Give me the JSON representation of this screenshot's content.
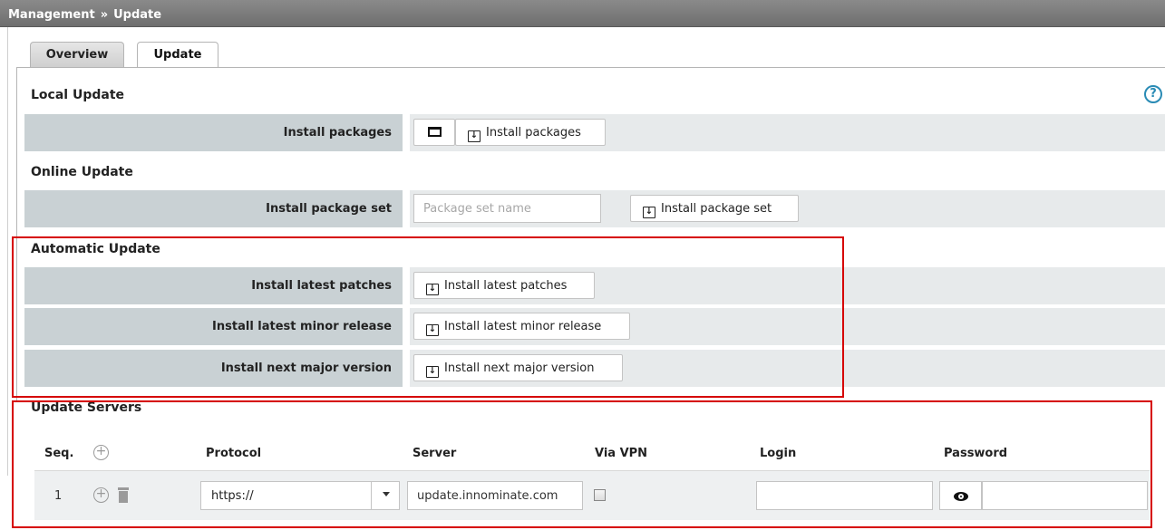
{
  "breadcrumb": {
    "parent": "Management",
    "separator": "»",
    "current": "Update"
  },
  "tabs": [
    {
      "label": "Overview"
    },
    {
      "label": "Update"
    }
  ],
  "help": {
    "glyph": "?"
  },
  "local_update": {
    "title": "Local Update",
    "install_packages": {
      "label": "Install packages",
      "button_label": "Install packages"
    }
  },
  "online_update": {
    "title": "Online Update",
    "install_package_set": {
      "label": "Install package set",
      "input_placeholder": "Package set name",
      "button_label": "Install package set"
    }
  },
  "automatic_update": {
    "title": "Automatic Update",
    "rows": [
      {
        "label": "Install latest patches",
        "button_label": "Install latest patches"
      },
      {
        "label": "Install latest minor release",
        "button_label": "Install latest minor release"
      },
      {
        "label": "Install next major version",
        "button_label": "Install next major version"
      }
    ]
  },
  "update_servers": {
    "title": "Update Servers",
    "columns": {
      "seq": "Seq.",
      "protocol": "Protocol",
      "server": "Server",
      "via_vpn": "Via VPN",
      "login": "Login",
      "password": "Password"
    },
    "rows": [
      {
        "seq": "1",
        "protocol": "https://",
        "server": "update.innominate.com",
        "via_vpn": false,
        "login": "",
        "password": ""
      }
    ]
  },
  "colors": {
    "topbar": "#7a7a7a",
    "label_band": "#c9d1d4",
    "value_band": "#e7eaeb",
    "highlight_box": "#d60000",
    "help_icon": "#2a8bb5"
  }
}
